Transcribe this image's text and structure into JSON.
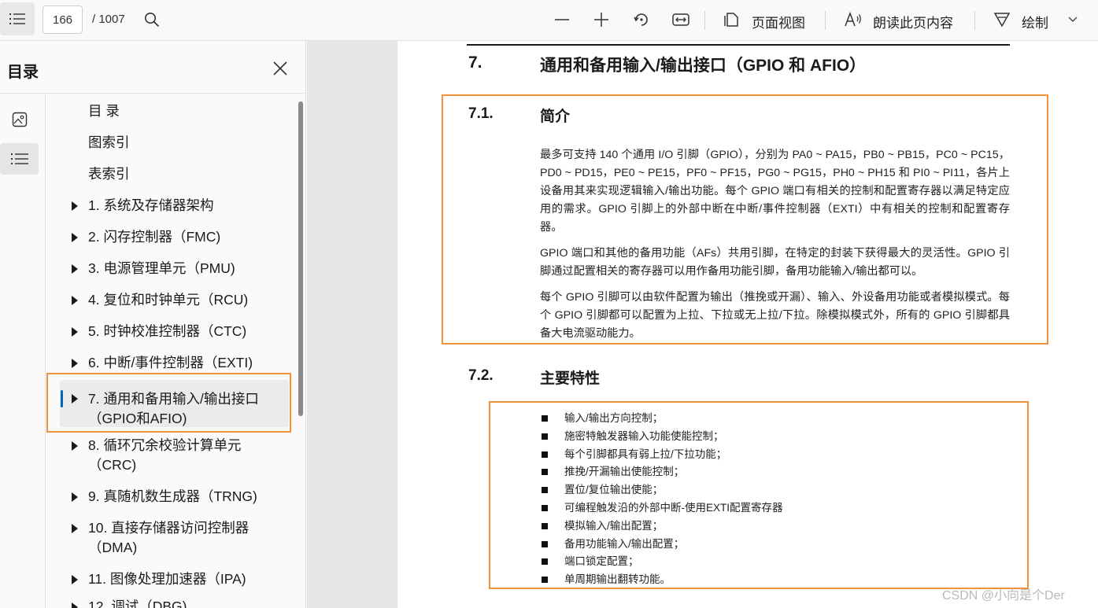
{
  "toolbar": {
    "page_number": "166",
    "page_total": "/ 1007",
    "page_view_label": "页面视图",
    "read_aloud_label": "朗读此页内容",
    "draw_label": "绘制"
  },
  "sidebar": {
    "title": "目录",
    "toc": [
      {
        "label": "目 录",
        "expandable": false
      },
      {
        "label": "图索引",
        "expandable": false
      },
      {
        "label": "表索引",
        "expandable": false
      },
      {
        "label": "1. 系统及存储器架构",
        "expandable": true
      },
      {
        "label": "2. 闪存控制器（FMC)",
        "expandable": true
      },
      {
        "label": "3. 电源管理单元（PMU)",
        "expandable": true
      },
      {
        "label": "4. 复位和时钟单元（RCU)",
        "expandable": true
      },
      {
        "label": "5. 时钟校准控制器（CTC)",
        "expandable": true
      },
      {
        "label": "6. 中断/事件控制器（EXTI)",
        "expandable": true
      },
      {
        "label": "7. 通用和备用输入/输出接口（GPIO和AFIO)",
        "expandable": true,
        "selected": true
      },
      {
        "label": "8. 循环冗余校验计算单元（CRC)",
        "expandable": true
      },
      {
        "label": "9. 真随机数生成器（TRNG)",
        "expandable": true
      },
      {
        "label": "10. 直接存储器访问控制器（DMA)",
        "expandable": true
      },
      {
        "label": "11. 图像处理加速器（IPA)",
        "expandable": true
      },
      {
        "label": "12. 调试（DBG)",
        "expandable": true
      }
    ]
  },
  "document": {
    "chapter_num": "7.",
    "chapter_title": "通用和备用输入/输出接口（GPIO 和 AFIO）",
    "sec1_num": "7.1.",
    "sec1_title": "简介",
    "sec1_paragraphs": [
      "最多可支持 140 个通用 I/O 引脚（GPIO），分别为 PA0 ~ PA15，PB0 ~ PB15，PC0 ~ PC15，PD0 ~ PD15，PE0 ~ PE15，PF0 ~ PF15，PG0 ~ PG15，PH0 ~ PH15 和 PI0 ~ PI11，各片上设备用其来实现逻辑输入/输出功能。每个 GPIO 端口有相关的控制和配置寄存器以满足特定应用的需求。GPIO 引脚上的外部中断在中断/事件控制器（EXTI）中有相关的控制和配置寄存器。",
      "GPIO 端口和其他的备用功能（AFs）共用引脚，在特定的封装下获得最大的灵活性。GPIO 引脚通过配置相关的寄存器可以用作备用功能引脚，备用功能输入/输出都可以。",
      "每个 GPIO 引脚可以由软件配置为输出（推挽或开漏）、输入、外设备用功能或者模拟模式。每个 GPIO 引脚都可以配置为上拉、下拉或无上拉/下拉。除模拟模式外，所有的 GPIO 引脚都具备大电流驱动能力。"
    ],
    "sec2_num": "7.2.",
    "sec2_title": "主要特性",
    "features": [
      "输入/输出方向控制；",
      "施密特触发器输入功能使能控制；",
      "每个引脚都具有弱上拉/下拉功能；",
      "推挽/开漏输出使能控制；",
      "置位/复位输出使能；",
      "可编程触发沿的外部中断-使用EXTI配置寄存器",
      "模拟输入/输出配置；",
      "备用功能输入/输出配置；",
      "端口锁定配置；",
      "单周期输出翻转功能。"
    ]
  },
  "watermark": "CSDN @小向是个Der",
  "colors": {
    "highlight_box": "#f0923c",
    "selection_bar": "#0067c0",
    "toolbar_bg": "#f9f9f9",
    "viewer_bg": "#e6e6e6"
  }
}
